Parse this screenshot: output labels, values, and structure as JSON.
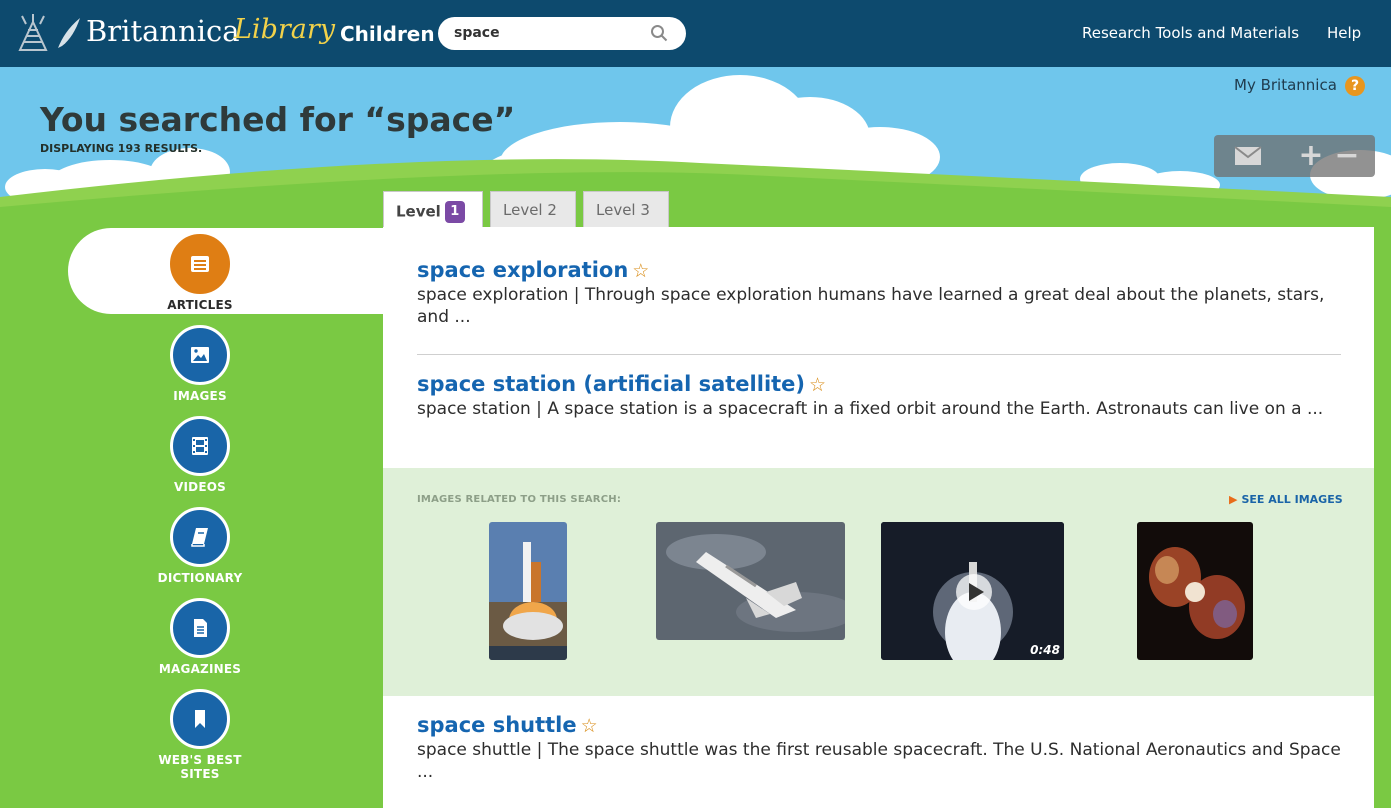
{
  "header": {
    "logo_text": "Britannica",
    "logo_library": "Library",
    "logo_children": "Children",
    "search_value": "space",
    "nav": [
      "Research Tools and Materials",
      "Help"
    ]
  },
  "banner": {
    "my_britannica": "My Britannica",
    "help_mark": "?",
    "title": "You searched for “space”",
    "results_count": "DISPLAYING 193 RESULTS.",
    "tools": [
      "envelope-icon",
      "plus-icon",
      "minus-icon"
    ]
  },
  "tabs": [
    {
      "label": "Level",
      "badge": "1",
      "active": true
    },
    {
      "label": "Level 2",
      "active": false
    },
    {
      "label": "Level 3",
      "active": false
    }
  ],
  "sidebar": {
    "items": [
      {
        "label": "ARTICLES",
        "icon": "list-icon",
        "active": true
      },
      {
        "label": "IMAGES",
        "icon": "image-icon",
        "active": false
      },
      {
        "label": "VIDEOS",
        "icon": "film-icon",
        "active": false
      },
      {
        "label": "DICTIONARY",
        "icon": "book-icon",
        "active": false
      },
      {
        "label": "MAGAZINES",
        "icon": "document-icon",
        "active": false
      },
      {
        "label": "WEB'S BEST SITES",
        "icon": "bookmark-icon",
        "active": false
      }
    ]
  },
  "results": [
    {
      "title": "space exploration",
      "snippet": "space exploration  |  Through space exploration humans have learned a great deal about the planets, stars, and ..."
    },
    {
      "title": "space station (artificial satellite)",
      "snippet": "space station  |  A space station is a spacecraft in a fixed orbit around the Earth. Astronauts can live on a ..."
    },
    {
      "title": "space shuttle",
      "snippet": "space shuttle  |  The space shuttle was the first reusable spacecraft. The U.S. National Aeronautics and Space ..."
    }
  ],
  "related": {
    "title": "IMAGES RELATED TO THIS SEARCH:",
    "see_all": "SEE ALL IMAGES",
    "video_duration": "0:48"
  },
  "colors": {
    "topbar": "#0d4a6e",
    "sky": "#6fc6ec",
    "grass": "#7ac943",
    "link": "#1565b0",
    "accent_orange": "#df7e14",
    "nav_blue": "#1965a8"
  }
}
